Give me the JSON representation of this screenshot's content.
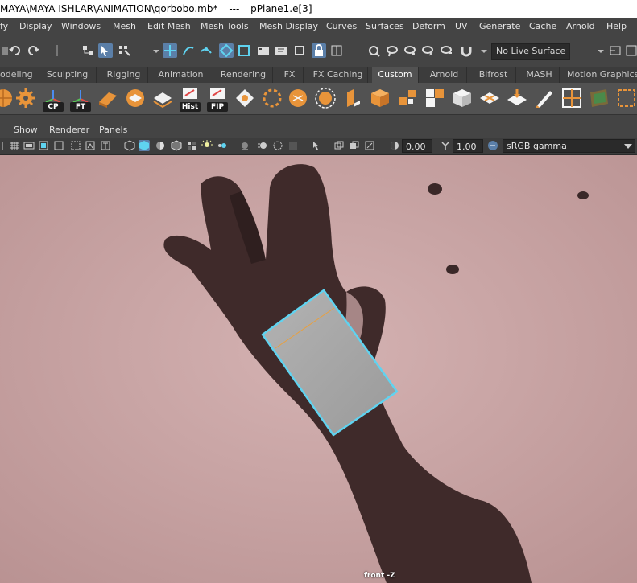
{
  "titlebar": {
    "path": "MAYA\\MAYA ISHLAR\\ANIMATION\\qorbobo.mb*",
    "separator": "---",
    "selection": "pPlane1.e[3]"
  },
  "menubar": {
    "items": [
      "fy",
      "Display",
      "Windows",
      "Mesh",
      "Edit Mesh",
      "Mesh Tools",
      "Mesh Display",
      "Curves",
      "Surfaces",
      "Deform",
      "UV",
      "Generate",
      "Cache",
      "Arnold",
      "Help"
    ]
  },
  "statusline": {
    "live_surface": "No Live Surface"
  },
  "shelf_tabs": {
    "items": [
      "odeling",
      "Sculpting",
      "Rigging",
      "Animation",
      "Rendering",
      "FX",
      "FX Caching",
      "Custom",
      "Arnold",
      "Bifrost",
      "MASH",
      "Motion Graphics"
    ],
    "active": "Custom"
  },
  "shelf": {
    "labels": {
      "cp": "CP",
      "ft": "FT",
      "hist": "Hist",
      "fip": "FIP"
    }
  },
  "panel_menu": {
    "items": [
      "Show",
      "Renderer",
      "Panels"
    ]
  },
  "panel_tools": {
    "exposure": "0.00",
    "gamma_value": "1.00",
    "color_space": "sRGB gamma"
  },
  "viewport": {
    "camera": "front -Z",
    "plane_color": "#a8a8a8",
    "highlight_color": "#5fd3f0",
    "edge_color": "#e8a040",
    "background_color": "#c9a6a6"
  },
  "colors": {
    "accent": "#5b7fa8",
    "orange": "#e8943a"
  }
}
